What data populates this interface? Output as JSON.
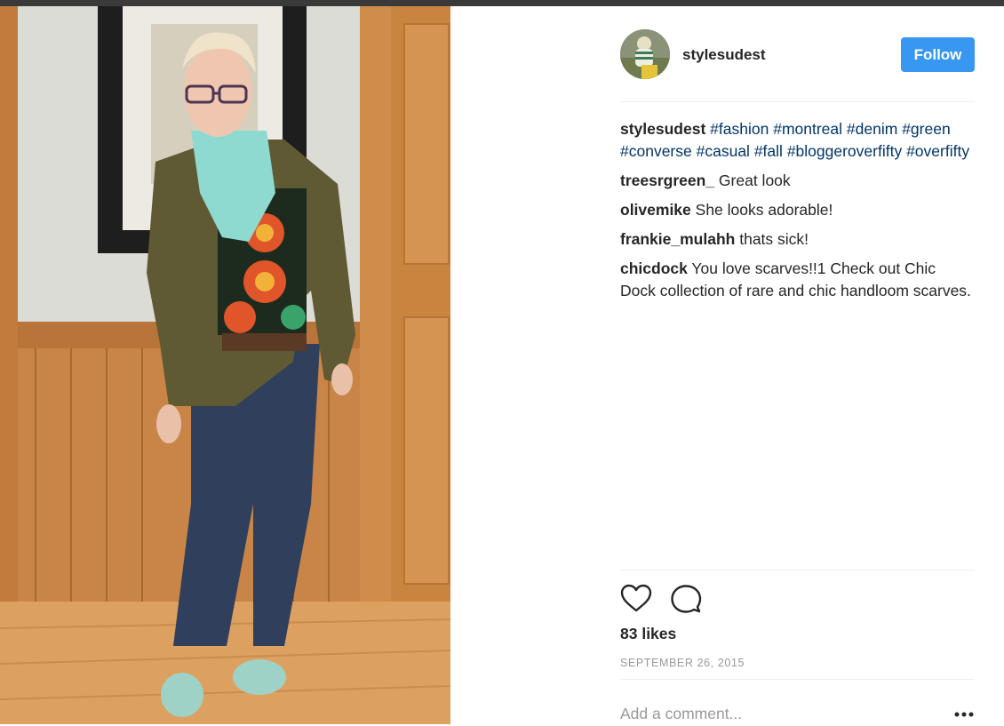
{
  "post": {
    "username": "stylesudest",
    "follow_label": "Follow",
    "caption": {
      "user": "stylesudest",
      "tags": [
        "#fashion",
        "#montreal",
        "#denim",
        "#green",
        "#converse",
        "#casual",
        "#fall",
        "#bloggeroverfifty",
        "#overfifty"
      ]
    },
    "comments": [
      {
        "user": "treesrgreen_",
        "text": "Great look"
      },
      {
        "user": "olivemike",
        "text": "She looks adorable!"
      },
      {
        "user": "frankie_mulahh",
        "text": "thats sick!"
      },
      {
        "user": "chicdock",
        "text": "You love scarves!!1 Check out Chic Dock collection of rare and chic handloom scarves."
      }
    ],
    "likes_label": "83 likes",
    "date": "SEPTEMBER 26, 2015",
    "add_comment_placeholder": "Add a comment...",
    "icons": {
      "like": "heart-icon",
      "comment": "comment-bubble-icon",
      "more": "more-options-icon"
    },
    "colors": {
      "accent": "#3897f0",
      "hashtag": "#003569",
      "muted": "#999999",
      "divider": "#efefef"
    }
  }
}
